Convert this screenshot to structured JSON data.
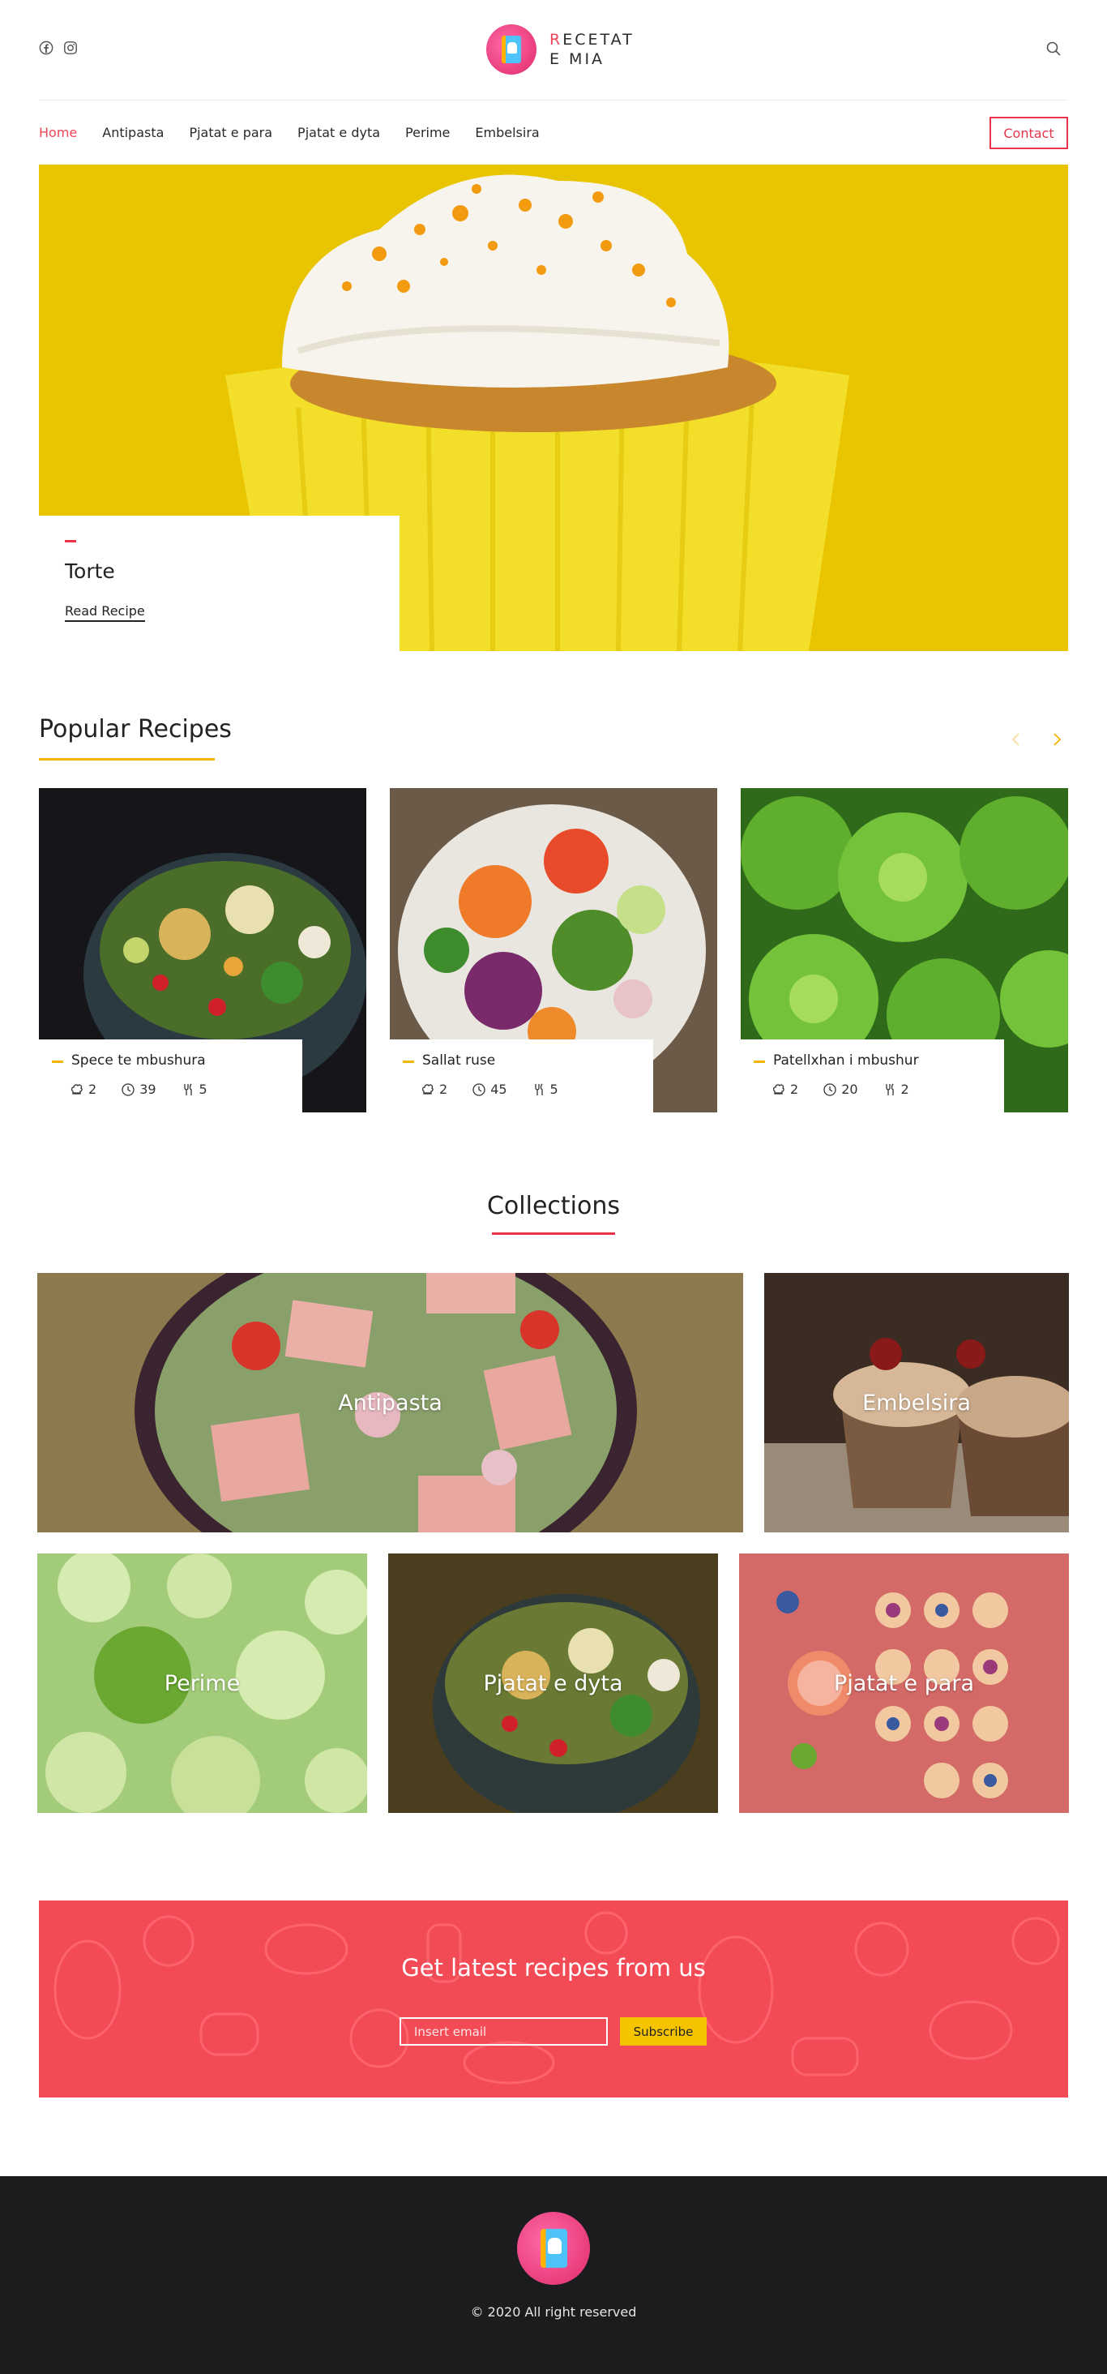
{
  "brand": {
    "logo_line1_first": "R",
    "logo_line1_rest": "ECETAT",
    "logo_line2": "E MIA",
    "accent": "#f0455a"
  },
  "header": {
    "icons": [
      "facebook-icon",
      "instagram-icon",
      "search-icon"
    ]
  },
  "nav": {
    "items": [
      {
        "label": "Home",
        "active": true
      },
      {
        "label": "Antipasta",
        "active": false
      },
      {
        "label": "Pjatat e para",
        "active": false
      },
      {
        "label": "Pjatat e dyta",
        "active": false
      },
      {
        "label": "Perime",
        "active": false
      },
      {
        "label": "Embelsira",
        "active": false
      }
    ],
    "contact_label": "Contact"
  },
  "hero": {
    "title": "Torte",
    "link_label": "Read Recipe"
  },
  "popular": {
    "title": "Popular Recipes",
    "recipes": [
      {
        "name": "Spece te mbushura",
        "servings": "2",
        "minutes": "39",
        "ingredients": "5"
      },
      {
        "name": "Sallat ruse",
        "servings": "2",
        "minutes": "45",
        "ingredients": "5"
      },
      {
        "name": "Patellxhan i mbushur",
        "servings": "2",
        "minutes": "20",
        "ingredients": "2"
      }
    ]
  },
  "collections": {
    "title": "Collections",
    "items": [
      "Antipasta",
      "Embelsira",
      "Perime",
      "Pjatat e dyta",
      "Pjatat e para"
    ]
  },
  "newsletter": {
    "title": "Get latest recipes from us",
    "placeholder": "Insert email",
    "button": "Subscribe"
  },
  "footer": {
    "copyright": "© 2020 All right reserved"
  }
}
